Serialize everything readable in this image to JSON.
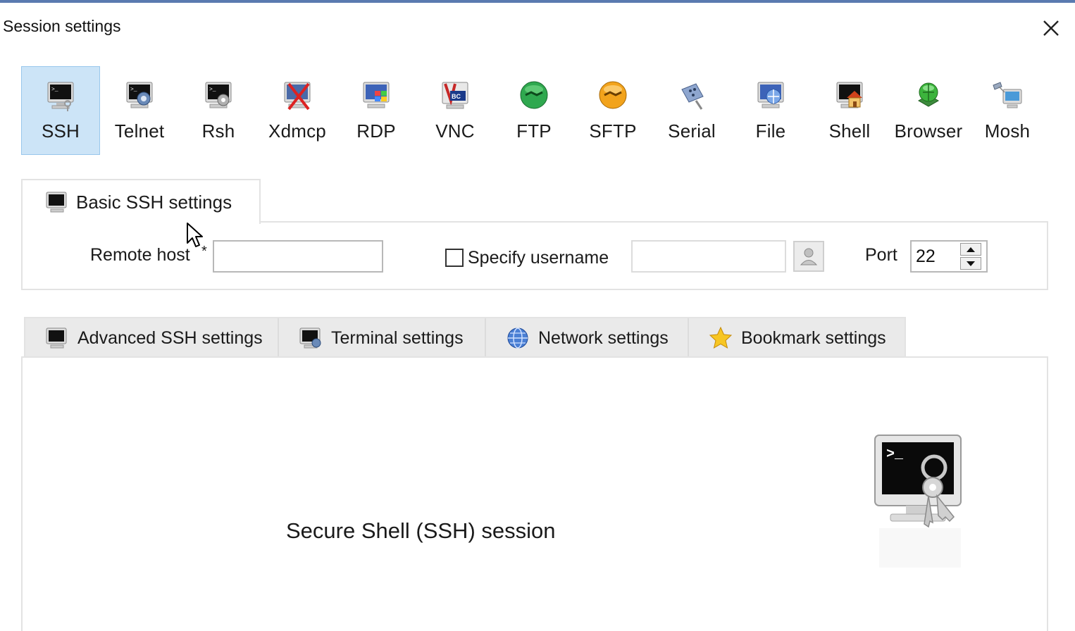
{
  "window": {
    "title": "Session settings"
  },
  "session_types": [
    {
      "label": "SSH",
      "icon": "ssh-terminal-icon",
      "selected": true
    },
    {
      "label": "Telnet",
      "icon": "telnet-terminal-icon",
      "selected": false
    },
    {
      "label": "Rsh",
      "icon": "rsh-terminal-icon",
      "selected": false
    },
    {
      "label": "Xdmcp",
      "icon": "xdmcp-icon",
      "selected": false
    },
    {
      "label": "RDP",
      "icon": "rdp-icon",
      "selected": false
    },
    {
      "label": "VNC",
      "icon": "vnc-icon",
      "selected": false
    },
    {
      "label": "FTP",
      "icon": "ftp-globe-icon",
      "selected": false
    },
    {
      "label": "SFTP",
      "icon": "sftp-globe-icon",
      "selected": false
    },
    {
      "label": "Serial",
      "icon": "serial-plug-icon",
      "selected": false
    },
    {
      "label": "File",
      "icon": "file-globe-icon",
      "selected": false
    },
    {
      "label": "Shell",
      "icon": "shell-house-icon",
      "selected": false
    },
    {
      "label": "Browser",
      "icon": "browser-globe-icon",
      "selected": false
    },
    {
      "label": "Mosh",
      "icon": "mosh-satellite-icon",
      "selected": false
    }
  ],
  "basic": {
    "tab_label": "Basic SSH settings",
    "remote_host_label": "Remote host",
    "required_marker": "*",
    "remote_host_value": "",
    "specify_username_label": "Specify username",
    "specify_username_checked": false,
    "username_value": "",
    "port_label": "Port",
    "port_value": "22"
  },
  "lower_tabs": [
    {
      "label": "Advanced SSH settings",
      "icon": "terminal-icon"
    },
    {
      "label": "Terminal settings",
      "icon": "terminal-settings-icon"
    },
    {
      "label": "Network settings",
      "icon": "globe-icon"
    },
    {
      "label": "Bookmark settings",
      "icon": "star-icon"
    }
  ],
  "panel": {
    "description": "Secure Shell (SSH) session"
  },
  "colors": {
    "selected_bg": "#cce4f7",
    "selected_border": "#99c7ec",
    "title_border": "#5a7ab0"
  }
}
